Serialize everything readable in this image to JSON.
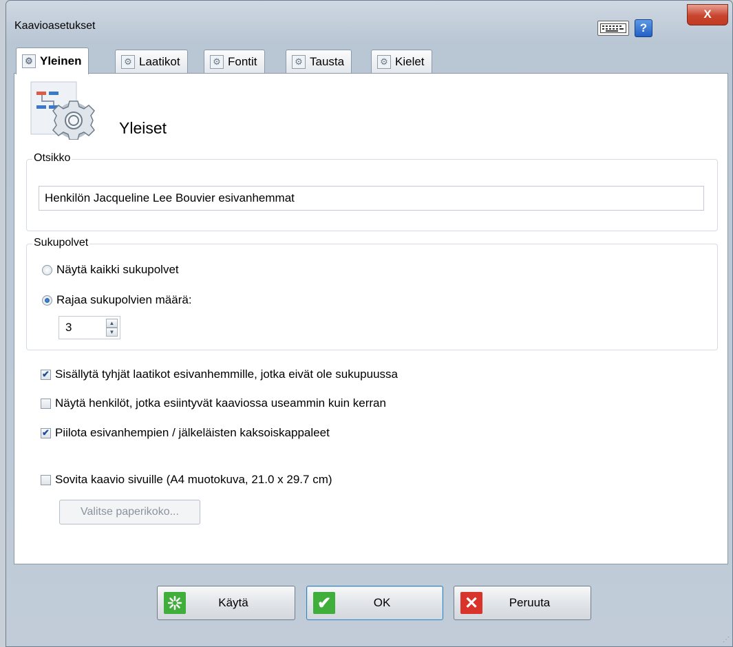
{
  "window": {
    "title": "Kaavioasetukset",
    "help_label": "?",
    "close_label": "X"
  },
  "tabs": [
    {
      "label": "Yleinen",
      "active": true
    },
    {
      "label": "Laatikot",
      "active": false
    },
    {
      "label": "Fontit",
      "active": false
    },
    {
      "label": "Tausta",
      "active": false
    },
    {
      "label": "Kielet",
      "active": false
    }
  ],
  "header": {
    "title": "Yleiset"
  },
  "title_group": {
    "legend": "Otsikko",
    "value": "Henkilön Jacqueline Lee Bouvier esivanhemmat"
  },
  "generations_group": {
    "legend": "Sukupolvet",
    "options": [
      {
        "label": "Näytä kaikki sukupolvet",
        "selected": false
      },
      {
        "label": "Rajaa sukupolvien määrä:",
        "selected": true
      }
    ],
    "count": "3"
  },
  "checkboxes": [
    {
      "label": "Sisällytä tyhjät laatikot esivanhemmille, jotka eivät ole sukupuussa",
      "checked": true
    },
    {
      "label": "Näytä henkilöt, jotka esiintyvät kaaviossa useammin kuin kerran",
      "checked": false
    },
    {
      "label": "Piilota esivanhempien / jälkeläisten kaksoiskappaleet",
      "checked": true
    },
    {
      "label": "Sovita kaavio sivuille (A4 muotokuva, 21.0 x 29.7 cm)",
      "checked": false
    }
  ],
  "paper_button": {
    "label": "Valitse paperikoko...",
    "enabled": false
  },
  "footer": {
    "apply_label": "Käytä",
    "ok_label": "OK",
    "cancel_label": "Peruuta"
  },
  "colors": {
    "apply_icon": "#3fae3a",
    "ok_icon": "#3fae3a",
    "cancel_icon": "#d9342b",
    "accent": "#3c7fb1"
  },
  "icons": {
    "keyboard": "keyboard-icon",
    "help": "help-icon",
    "close": "close-icon",
    "tab": "settings-icon",
    "header": "chart-settings-icon",
    "apply": "apply-icon",
    "ok": "checkmark-icon",
    "cancel": "cancel-icon"
  }
}
